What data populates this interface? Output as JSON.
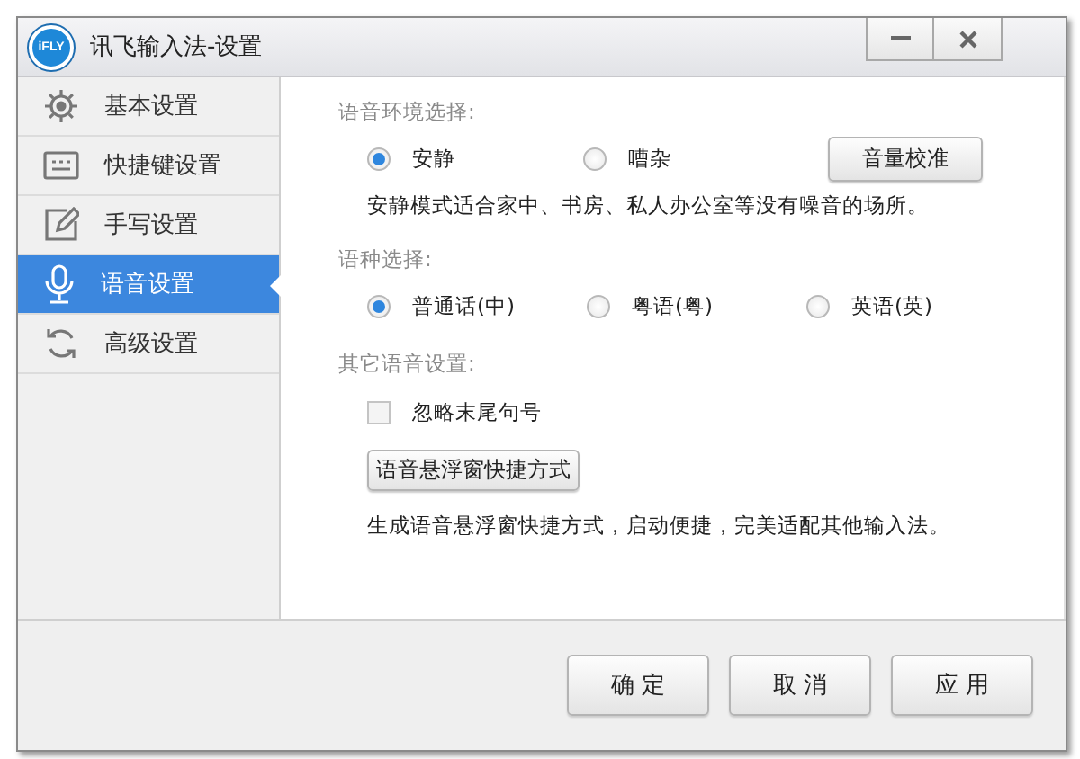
{
  "window": {
    "title": "讯飞输入法-设置",
    "logo": "iFLY"
  },
  "sidebar": {
    "items": [
      {
        "label": "基本设置",
        "selected": false
      },
      {
        "label": "快捷键设置",
        "selected": false
      },
      {
        "label": "手写设置",
        "selected": false
      },
      {
        "label": "语音设置",
        "selected": true
      },
      {
        "label": "高级设置",
        "selected": false
      }
    ]
  },
  "environment": {
    "heading": "语音环境选择:",
    "options": [
      {
        "label": "安静",
        "selected": true
      },
      {
        "label": "嘈杂",
        "selected": false
      }
    ],
    "button": "音量校准",
    "description": "安静模式适合家中、书房、私人办公室等没有噪音的场所。"
  },
  "language": {
    "heading": "语种选择:",
    "options": [
      {
        "label": "普通话(中)",
        "selected": true
      },
      {
        "label": "粤语(粤)",
        "selected": false
      },
      {
        "label": "英语(英)",
        "selected": false
      }
    ]
  },
  "other": {
    "heading": "其它语音设置:",
    "checkbox": {
      "label": "忽略末尾句号",
      "checked": false
    },
    "button": "语音悬浮窗快捷方式",
    "description": "生成语音悬浮窗快捷方式，启动便捷，完美适配其他输入法。"
  },
  "footer": {
    "buttons": [
      "确 定",
      "取 消",
      "应 用"
    ]
  }
}
